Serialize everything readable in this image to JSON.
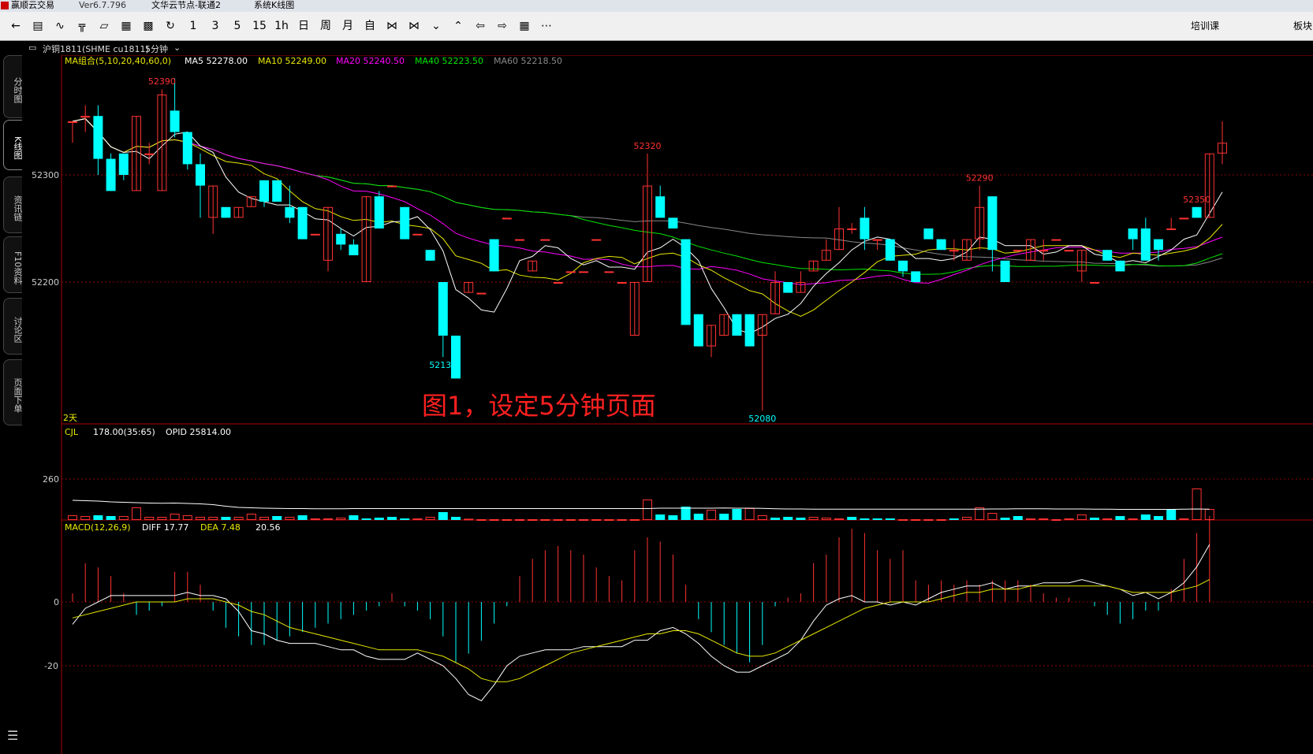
{
  "titlebar": {
    "app": "赢顺云交易",
    "version": "Ver6.7.796",
    "node": "文华云节点-联通2",
    "menu": "系统K线图"
  },
  "toolbar": {
    "icons": [
      "back-icon",
      "list-icon",
      "line-chart-icon",
      "split-icon",
      "bar-chart-icon",
      "grid-icon",
      "save-icon",
      "refresh-icon"
    ],
    "periods": [
      "1",
      "3",
      "5",
      "15",
      "1h",
      "日",
      "周",
      "月",
      "自"
    ],
    "right_labels": [
      "培训课",
      "板块"
    ]
  },
  "sidebar": {
    "tabs": [
      "分时图",
      "K线图",
      "资讯链",
      "F10资料",
      "讨论区",
      "页面下单"
    ]
  },
  "symbol": {
    "name": "沪铜1811(SHME cu1811)",
    "period": "5分钟"
  },
  "ma_legend": {
    "combo": "MA组合(5,10,20,40,60,0)",
    "items": [
      {
        "label": "MA5 52278.00",
        "color": "#ffffff"
      },
      {
        "label": "MA10 52249.00",
        "color": "#e8e800"
      },
      {
        "label": "MA20 52240.50",
        "color": "#ff00ff"
      },
      {
        "label": "MA40 52223.50",
        "color": "#00e600"
      },
      {
        "label": "MA60 52218.50",
        "color": "#888888"
      }
    ]
  },
  "volume_legend": {
    "label": "CJL",
    "value": "178.00(35:65)",
    "opid": "OPID 25814.00"
  },
  "macd_legend": {
    "label": "MACD(12,26,9)",
    "diff": "DIFF 17.77",
    "dea": "DEA 7.48",
    "macd": "20.56"
  },
  "annotation": "图1，设定5分钟页面",
  "day_label": "2天",
  "colors": {
    "up": "#ff3232",
    "down": "#00ffff",
    "grid": "#8b0000",
    "ma5": "#ffffff",
    "ma10": "#e8e800",
    "ma20": "#ff00ff",
    "ma40": "#00e600",
    "ma60": "#888888",
    "dea": "#e8e800"
  },
  "chart_data": {
    "type": "candlestick",
    "price_axis": {
      "ticks": [
        52300,
        52200
      ],
      "labels": [
        "52300",
        "52200"
      ]
    },
    "volume_axis": {
      "ticks": [
        260
      ],
      "labels": [
        "260"
      ]
    },
    "macd_axis": {
      "ticks": [
        0,
        -20
      ],
      "labels": [
        "0",
        "-20"
      ]
    },
    "peak_labels": [
      {
        "label": "52390",
        "index": 7,
        "type": "high"
      },
      {
        "label": "52130",
        "index": 29,
        "type": "low"
      },
      {
        "label": "52320",
        "index": 45,
        "type": "high"
      },
      {
        "label": "52080",
        "index": 54,
        "type": "low"
      },
      {
        "label": "52290",
        "index": 71,
        "type": "high"
      },
      {
        "label": "52350",
        "index": 88,
        "type": "high"
      }
    ],
    "candles": [
      {
        "o": 52350,
        "h": 52350,
        "l": 52330,
        "c": 52350
      },
      {
        "o": 52355,
        "h": 52365,
        "l": 52340,
        "c": 52355
      },
      {
        "o": 52355,
        "h": 52365,
        "l": 52300,
        "c": 52315
      },
      {
        "o": 52315,
        "h": 52320,
        "l": 52285,
        "c": 52285
      },
      {
        "o": 52320,
        "h": 52320,
        "l": 52295,
        "c": 52300
      },
      {
        "o": 52285,
        "h": 52355,
        "l": 52285,
        "c": 52355
      },
      {
        "o": 52320,
        "h": 52330,
        "l": 52310,
        "c": 52320
      },
      {
        "o": 52285,
        "h": 52380,
        "l": 52285,
        "c": 52375
      },
      {
        "o": 52360,
        "h": 52390,
        "l": 52335,
        "c": 52340
      },
      {
        "o": 52340,
        "h": 52340,
        "l": 52305,
        "c": 52310
      },
      {
        "o": 52310,
        "h": 52320,
        "l": 52260,
        "c": 52290
      },
      {
        "o": 52260,
        "h": 52290,
        "l": 52245,
        "c": 52290
      },
      {
        "o": 52270,
        "h": 52270,
        "l": 52260,
        "c": 52260
      },
      {
        "o": 52260,
        "h": 52270,
        "l": 52260,
        "c": 52270
      },
      {
        "o": 52270,
        "h": 52280,
        "l": 52270,
        "c": 52280
      },
      {
        "o": 52295,
        "h": 52295,
        "l": 52270,
        "c": 52275
      },
      {
        "o": 52295,
        "h": 52295,
        "l": 52275,
        "c": 52275
      },
      {
        "o": 52270,
        "h": 52290,
        "l": 52255,
        "c": 52260
      },
      {
        "o": 52270,
        "h": 52270,
        "l": 52240,
        "c": 52240
      },
      {
        "o": 52245,
        "h": 52245,
        "l": 52245,
        "c": 52245
      },
      {
        "o": 52220,
        "h": 52270,
        "l": 52210,
        "c": 52270
      },
      {
        "o": 52245,
        "h": 52250,
        "l": 52230,
        "c": 52235
      },
      {
        "o": 52235,
        "h": 52240,
        "l": 52225,
        "c": 52225
      },
      {
        "o": 52200,
        "h": 52280,
        "l": 52200,
        "c": 52280
      },
      {
        "o": 52280,
        "h": 52285,
        "l": 52250,
        "c": 52250
      },
      {
        "o": 52290,
        "h": 52290,
        "l": 52290,
        "c": 52290
      },
      {
        "o": 52270,
        "h": 52270,
        "l": 52240,
        "c": 52240
      },
      {
        "o": 52245,
        "h": 52245,
        "l": 52245,
        "c": 52245
      },
      {
        "o": 52230,
        "h": 52230,
        "l": 52220,
        "c": 52220
      },
      {
        "o": 52200,
        "h": 52200,
        "l": 52130,
        "c": 52150
      },
      {
        "o": 52150,
        "h": 52150,
        "l": 52110,
        "c": 52110
      },
      {
        "o": 52190,
        "h": 52200,
        "l": 52190,
        "c": 52200
      },
      {
        "o": 52190,
        "h": 52190,
        "l": 52190,
        "c": 52190
      },
      {
        "o": 52240,
        "h": 52240,
        "l": 52210,
        "c": 52210
      },
      {
        "o": 52260,
        "h": 52260,
        "l": 52260,
        "c": 52260
      },
      {
        "o": 52240,
        "h": 52240,
        "l": 52240,
        "c": 52240
      },
      {
        "o": 52210,
        "h": 52220,
        "l": 52210,
        "c": 52220
      },
      {
        "o": 52240,
        "h": 52240,
        "l": 52240,
        "c": 52240
      },
      {
        "o": 52200,
        "h": 52200,
        "l": 52200,
        "c": 52200
      },
      {
        "o": 52210,
        "h": 52210,
        "l": 52210,
        "c": 52210
      },
      {
        "o": 52210,
        "h": 52210,
        "l": 52210,
        "c": 52210
      },
      {
        "o": 52240,
        "h": 52240,
        "l": 52240,
        "c": 52240
      },
      {
        "o": 52210,
        "h": 52210,
        "l": 52210,
        "c": 52210
      },
      {
        "o": 52200,
        "h": 52200,
        "l": 52200,
        "c": 52200
      },
      {
        "o": 52150,
        "h": 52200,
        "l": 52150,
        "c": 52200
      },
      {
        "o": 52200,
        "h": 52320,
        "l": 52200,
        "c": 52290
      },
      {
        "o": 52280,
        "h": 52290,
        "l": 52260,
        "c": 52260
      },
      {
        "o": 52260,
        "h": 52260,
        "l": 52250,
        "c": 52250
      },
      {
        "o": 52240,
        "h": 52240,
        "l": 52160,
        "c": 52160
      },
      {
        "o": 52170,
        "h": 52170,
        "l": 52140,
        "c": 52140
      },
      {
        "o": 52140,
        "h": 52160,
        "l": 52130,
        "c": 52160
      },
      {
        "o": 52150,
        "h": 52170,
        "l": 52150,
        "c": 52170
      },
      {
        "o": 52170,
        "h": 52170,
        "l": 52150,
        "c": 52150
      },
      {
        "o": 52170,
        "h": 52170,
        "l": 52140,
        "c": 52140
      },
      {
        "o": 52150,
        "h": 52170,
        "l": 52080,
        "c": 52170
      },
      {
        "o": 52170,
        "h": 52210,
        "l": 52170,
        "c": 52200
      },
      {
        "o": 52200,
        "h": 52200,
        "l": 52190,
        "c": 52190
      },
      {
        "o": 52190,
        "h": 52210,
        "l": 52190,
        "c": 52200
      },
      {
        "o": 52210,
        "h": 52220,
        "l": 52210,
        "c": 52220
      },
      {
        "o": 52220,
        "h": 52240,
        "l": 52220,
        "c": 52230
      },
      {
        "o": 52230,
        "h": 52270,
        "l": 52230,
        "c": 52250
      },
      {
        "o": 52250,
        "h": 52255,
        "l": 52245,
        "c": 52250
      },
      {
        "o": 52260,
        "h": 52270,
        "l": 52230,
        "c": 52240
      },
      {
        "o": 52240,
        "h": 52240,
        "l": 52230,
        "c": 52240
      },
      {
        "o": 52240,
        "h": 52240,
        "l": 52220,
        "c": 52220
      },
      {
        "o": 52220,
        "h": 52220,
        "l": 52205,
        "c": 52210
      },
      {
        "o": 52210,
        "h": 52210,
        "l": 52200,
        "c": 52200
      },
      {
        "o": 52250,
        "h": 52250,
        "l": 52240,
        "c": 52240
      },
      {
        "o": 52240,
        "h": 52240,
        "l": 52230,
        "c": 52230
      },
      {
        "o": 52230,
        "h": 52240,
        "l": 52220,
        "c": 52230
      },
      {
        "o": 52220,
        "h": 52240,
        "l": 52220,
        "c": 52240
      },
      {
        "o": 52240,
        "h": 52290,
        "l": 52230,
        "c": 52270
      },
      {
        "o": 52280,
        "h": 52280,
        "l": 52210,
        "c": 52230
      },
      {
        "o": 52220,
        "h": 52220,
        "l": 52200,
        "c": 52200
      },
      {
        "o": 52230,
        "h": 52230,
        "l": 52230,
        "c": 52230
      },
      {
        "o": 52220,
        "h": 52240,
        "l": 52220,
        "c": 52240
      },
      {
        "o": 52230,
        "h": 52240,
        "l": 52220,
        "c": 52230
      },
      {
        "o": 52240,
        "h": 52240,
        "l": 52240,
        "c": 52240
      },
      {
        "o": 52230,
        "h": 52230,
        "l": 52230,
        "c": 52230
      },
      {
        "o": 52210,
        "h": 52230,
        "l": 52200,
        "c": 52230
      },
      {
        "o": 52200,
        "h": 52200,
        "l": 52200,
        "c": 52200
      },
      {
        "o": 52230,
        "h": 52230,
        "l": 52220,
        "c": 52220
      },
      {
        "o": 52220,
        "h": 52220,
        "l": 52210,
        "c": 52210
      },
      {
        "o": 52250,
        "h": 52250,
        "l": 52230,
        "c": 52240
      },
      {
        "o": 52250,
        "h": 52260,
        "l": 52220,
        "c": 52220
      },
      {
        "o": 52240,
        "h": 52240,
        "l": 52220,
        "c": 52230
      },
      {
        "o": 52250,
        "h": 52260,
        "l": 52250,
        "c": 52250
      },
      {
        "o": 52260,
        "h": 52260,
        "l": 52260,
        "c": 52260
      },
      {
        "o": 52270,
        "h": 52270,
        "l": 52260,
        "c": 52260
      },
      {
        "o": 52260,
        "h": 52320,
        "l": 52260,
        "c": 52320
      },
      {
        "o": 52320,
        "h": 52350,
        "l": 52310,
        "c": 52330
      }
    ],
    "volume": [
      {
        "v": 30,
        "up": true
      },
      {
        "v": 25,
        "up": true
      },
      {
        "v": 30,
        "up": false
      },
      {
        "v": 25,
        "up": false
      },
      {
        "v": 25,
        "up": true
      },
      {
        "v": 80,
        "up": true
      },
      {
        "v": 20,
        "up": true
      },
      {
        "v": 20,
        "up": true
      },
      {
        "v": 40,
        "up": true
      },
      {
        "v": 30,
        "up": true
      },
      {
        "v": 20,
        "up": true
      },
      {
        "v": 20,
        "up": true
      },
      {
        "v": 20,
        "up": false
      },
      {
        "v": 20,
        "up": true
      },
      {
        "v": 40,
        "up": true
      },
      {
        "v": 20,
        "up": true
      },
      {
        "v": 25,
        "up": false
      },
      {
        "v": 20,
        "up": true
      },
      {
        "v": 30,
        "up": false
      },
      {
        "v": 10,
        "up": true
      },
      {
        "v": 10,
        "up": true
      },
      {
        "v": 15,
        "up": true
      },
      {
        "v": 30,
        "up": false
      },
      {
        "v": 10,
        "up": false
      },
      {
        "v": 15,
        "up": false
      },
      {
        "v": 20,
        "up": false
      },
      {
        "v": 10,
        "up": false
      },
      {
        "v": 10,
        "up": true
      },
      {
        "v": 20,
        "up": true
      },
      {
        "v": 50,
        "up": false
      },
      {
        "v": 20,
        "up": false
      },
      {
        "v": 8,
        "up": true
      },
      {
        "v": 5,
        "up": true
      },
      {
        "v": 5,
        "up": true
      },
      {
        "v": 5,
        "up": true
      },
      {
        "v": 5,
        "up": true
      },
      {
        "v": 5,
        "up": true
      },
      {
        "v": 5,
        "up": true
      },
      {
        "v": 5,
        "up": true
      },
      {
        "v": 5,
        "up": true
      },
      {
        "v": 5,
        "up": true
      },
      {
        "v": 5,
        "up": true
      },
      {
        "v": 5,
        "up": true
      },
      {
        "v": 5,
        "up": true
      },
      {
        "v": 5,
        "up": true
      },
      {
        "v": 130,
        "up": true
      },
      {
        "v": 35,
        "up": false
      },
      {
        "v": 30,
        "up": false
      },
      {
        "v": 85,
        "up": false
      },
      {
        "v": 40,
        "up": false
      },
      {
        "v": 65,
        "up": true
      },
      {
        "v": 40,
        "up": false
      },
      {
        "v": 70,
        "up": false
      },
      {
        "v": 75,
        "up": true
      },
      {
        "v": 30,
        "up": true
      },
      {
        "v": 15,
        "up": false
      },
      {
        "v": 20,
        "up": false
      },
      {
        "v": 15,
        "up": false
      },
      {
        "v": 20,
        "up": true
      },
      {
        "v": 15,
        "up": true
      },
      {
        "v": 10,
        "up": true
      },
      {
        "v": 20,
        "up": false
      },
      {
        "v": 10,
        "up": false
      },
      {
        "v": 10,
        "up": false
      },
      {
        "v": 10,
        "up": false
      },
      {
        "v": 5,
        "up": true
      },
      {
        "v": 5,
        "up": true
      },
      {
        "v": 5,
        "up": true
      },
      {
        "v": 5,
        "up": true
      },
      {
        "v": 10,
        "up": false
      },
      {
        "v": 20,
        "up": true
      },
      {
        "v": 80,
        "up": true
      },
      {
        "v": 45,
        "up": true
      },
      {
        "v": 15,
        "up": false
      },
      {
        "v": 25,
        "up": false
      },
      {
        "v": 10,
        "up": true
      },
      {
        "v": 10,
        "up": true
      },
      {
        "v": 5,
        "up": true
      },
      {
        "v": 10,
        "up": true
      },
      {
        "v": 35,
        "up": true
      },
      {
        "v": 15,
        "up": false
      },
      {
        "v": 10,
        "up": true
      },
      {
        "v": 25,
        "up": false
      },
      {
        "v": 10,
        "up": true
      },
      {
        "v": 35,
        "up": false
      },
      {
        "v": 25,
        "up": false
      },
      {
        "v": 70,
        "up": false
      },
      {
        "v": 10,
        "up": true
      },
      {
        "v": 200,
        "up": true
      },
      {
        "v": 70,
        "up": true
      }
    ],
    "macd_hist": [
      2,
      9,
      8,
      6,
      2,
      -3,
      -2,
      -1,
      7,
      7,
      4,
      -2,
      -6,
      -8,
      -10,
      -10,
      -9,
      -8,
      -7,
      -6,
      -5,
      -4,
      -3,
      -2,
      -1,
      2,
      -1,
      -2,
      -4,
      -8,
      -14,
      -12,
      -9,
      -5,
      -1,
      6,
      10,
      12,
      13,
      12,
      11,
      8,
      6,
      5,
      12,
      15,
      14,
      11,
      4,
      -4,
      -7,
      -10,
      -12,
      -14,
      -10,
      -1,
      1,
      2,
      9,
      11,
      15,
      17,
      16,
      12,
      10,
      12,
      5,
      4,
      5,
      4,
      5,
      4,
      5,
      5,
      5,
      4,
      2,
      1,
      1,
      0,
      -1,
      -3,
      -5,
      -4,
      -2,
      -2,
      3,
      10,
      16,
      20
    ],
    "macd_diff": [
      -7,
      -2,
      0,
      2,
      2,
      2,
      2,
      2,
      2,
      3,
      2,
      2,
      1,
      -3,
      -9,
      -10,
      -12,
      -13,
      -13,
      -13,
      -14,
      -15,
      -15,
      -17,
      -18,
      -18,
      -18,
      -16,
      -18,
      -20,
      -24,
      -29,
      -31,
      -26,
      -20,
      -17,
      -16,
      -15,
      -15,
      -15,
      -14,
      -14,
      -14,
      -14,
      -12,
      -12,
      -9,
      -8,
      -10,
      -13,
      -17,
      -20,
      -22,
      -22,
      -20,
      -18,
      -16,
      -12,
      -6,
      -1,
      1,
      2,
      0,
      0,
      -1,
      0,
      -1,
      1,
      3,
      4,
      5,
      5,
      6,
      4,
      5,
      5,
      6,
      6,
      6,
      7,
      6,
      5,
      4,
      2,
      3,
      1,
      3,
      6,
      11,
      18
    ],
    "macd_dea": [
      -5,
      -4,
      -3,
      -2,
      -1,
      0,
      0,
      0,
      0,
      1,
      1,
      1,
      0,
      -1,
      -3,
      -4,
      -6,
      -8,
      -9,
      -10,
      -11,
      -12,
      -13,
      -14,
      -15,
      -15,
      -15,
      -15,
      -16,
      -17,
      -19,
      -21,
      -24,
      -25,
      -25,
      -24,
      -22,
      -20,
      -18,
      -16,
      -15,
      -14,
      -13,
      -12,
      -11,
      -10,
      -10,
      -9,
      -9,
      -10,
      -12,
      -14,
      -16,
      -17,
      -17,
      -16,
      -14,
      -12,
      -10,
      -8,
      -6,
      -4,
      -2,
      -1,
      0,
      0,
      0,
      0,
      1,
      2,
      3,
      3,
      4,
      4,
      4,
      5,
      5,
      5,
      5,
      5,
      5,
      5,
      4,
      3,
      3,
      3,
      3,
      4,
      5,
      7
    ],
    "volume_ma": [
      400,
      390,
      380,
      360,
      350,
      340,
      330,
      325,
      330,
      320,
      310,
      290,
      250,
      220,
      210,
      200,
      195,
      190,
      190,
      185,
      185,
      185,
      190,
      190,
      190,
      190,
      190,
      190,
      190,
      190,
      190,
      190,
      190,
      190,
      190,
      190,
      190,
      190,
      190,
      190,
      190,
      190,
      190,
      190,
      190,
      190,
      200,
      200,
      200,
      200,
      200,
      205,
      200,
      200,
      195,
      185,
      180,
      180,
      175,
      175,
      175,
      175,
      175,
      175,
      175,
      175,
      175,
      175,
      175,
      175,
      175,
      175,
      180,
      180,
      185,
      185,
      185,
      180,
      180,
      180,
      175,
      175,
      170,
      170,
      170,
      170,
      170,
      175,
      180,
      175
    ]
  }
}
